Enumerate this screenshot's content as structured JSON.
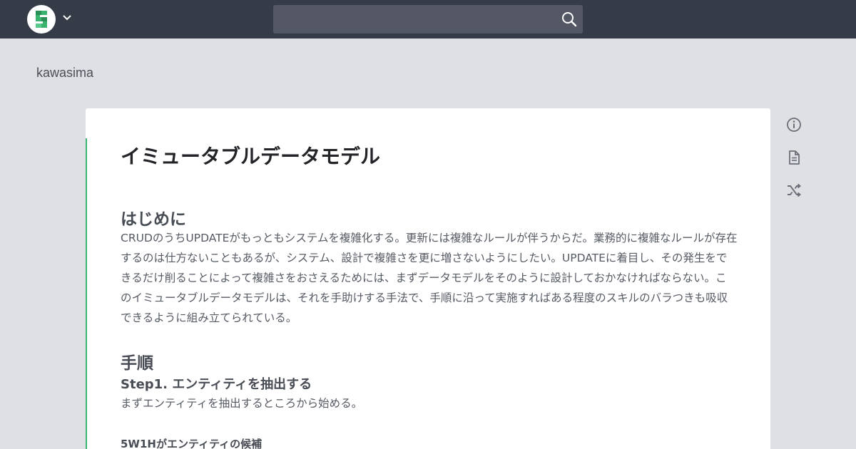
{
  "header": {
    "search_value": "",
    "logo_icon": "esa-logo-icon",
    "dropdown_icon": "chevron-down-icon",
    "search_icon": "search-icon"
  },
  "team": {
    "name": "kawasima"
  },
  "post": {
    "title": "イミュータブルデータモデル",
    "sections": {
      "intro_heading": "はじめに",
      "intro_body": "CRUDのうちUPDATEがもっともシステムを複雑化する。更新には複雑なルールが伴うからだ。業務的に複雑なルールが存在するのは仕方ないこともあるが、システム、設計で複雑さを更に増さないようにしたい。UPDATEに着目し、その発生をできるだけ削ることによって複雑さをおさえるためには、まずデータモデルをそのように設計しておかなければならない。このイミュータブルデータモデルは、それを手助けする手法で、手順に沿って実施すればある程度のスキルのバラつきも吸収できるように組み立てられている。",
      "steps_heading": "手順",
      "step1_heading": "Step1. エンティティを抽出する",
      "step1_body": "まずエンティティを抽出するところから始める。",
      "step1_sub_heading": "5W1Hがエンティティの候補"
    }
  },
  "side_actions": {
    "info_icon": "info-icon",
    "document_icon": "document-icon",
    "shuffle_icon": "shuffle-icon"
  },
  "colors": {
    "topbar": "#363b48",
    "background": "#dfe0e3",
    "accent": "#3bb572"
  }
}
